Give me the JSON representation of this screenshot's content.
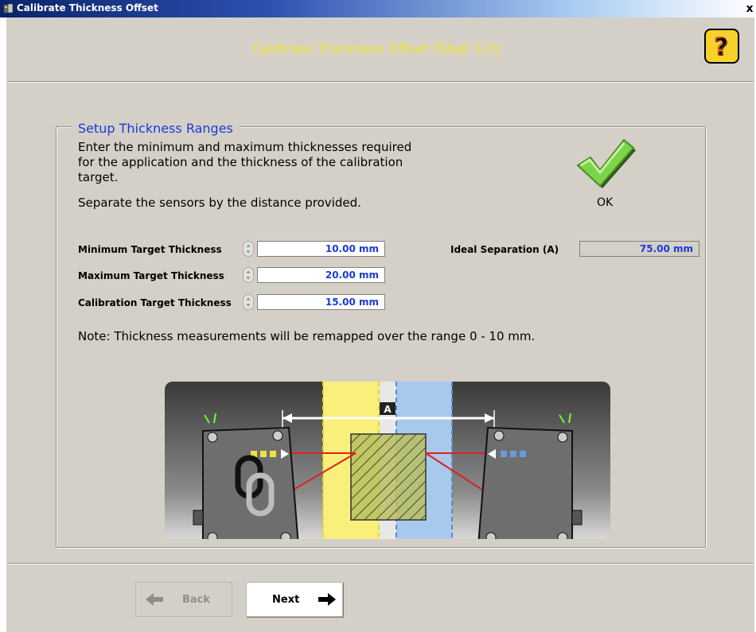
{
  "window": {
    "title": "Calibrate Thickness Offset",
    "close_label": "x"
  },
  "header": {
    "title": "Calibrate Thickness Offset (Step 1/3)",
    "help_icon": "question-icon"
  },
  "group": {
    "legend": "Setup Thickness Ranges",
    "description": [
      "Enter the minimum and maximum thicknesses required",
      "for the application and the thickness of the calibration",
      "target."
    ],
    "instruction": "Separate the sensors by the distance provided.",
    "status": {
      "label": "OK",
      "icon": "check-icon",
      "color": "#7cd44a"
    },
    "fields": [
      {
        "label": "Minimum Target Thickness",
        "value": "10.00 mm"
      },
      {
        "label": "Maximum Target Thickness",
        "value": "20.00 mm"
      },
      {
        "label": "Calibration Target Thickness",
        "value": "15.00 mm"
      }
    ],
    "ideal_separation": {
      "label": "Ideal Separation (A)",
      "value": "75.00 mm"
    },
    "note": "Note: Thickness measurements will be remapped over the range 0 - 10 mm.",
    "diagram": {
      "distance_label": "A",
      "colors": {
        "yellow": "#f8f07a",
        "blue": "#a8c8ec",
        "laser": "#e02020"
      }
    }
  },
  "nav": {
    "back_label": "Back",
    "next_label": "Next"
  }
}
